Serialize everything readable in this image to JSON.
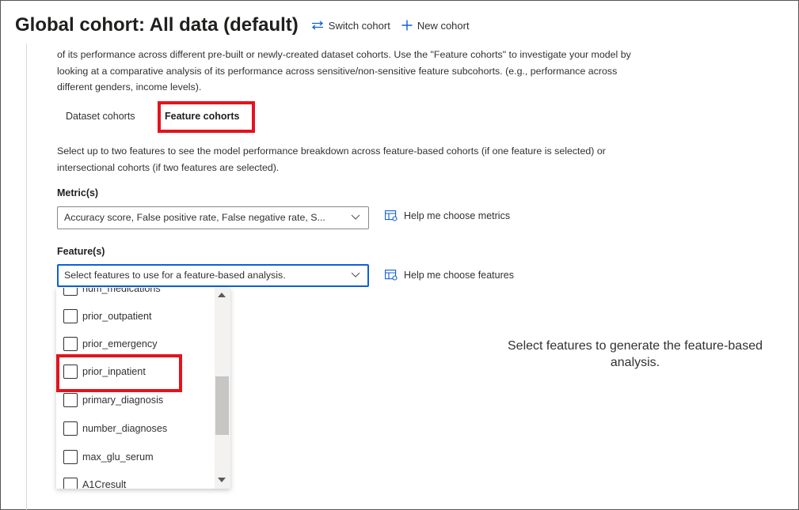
{
  "header": {
    "title": "Global cohort: All data (default)",
    "switch_cohort": "Switch cohort",
    "new_cohort": "New cohort"
  },
  "intro_text": "of its performance across different pre-built or newly-created dataset cohorts. Use the \"Feature cohorts\" to investigate your model by looking at a comparative analysis of its performance across sensitive/non-sensitive feature subcohorts. (e.g., performance across different genders, income levels).",
  "tabs": [
    {
      "label": "Dataset cohorts",
      "selected": false
    },
    {
      "label": "Feature cohorts",
      "selected": true
    }
  ],
  "description": "Select up to two features to see the model performance breakdown across feature-based cohorts (if one feature is selected) or intersectional cohorts (if two features are selected).",
  "metrics": {
    "label": "Metric(s)",
    "value": "Accuracy score, False positive rate, False negative rate, S...",
    "help": "Help me choose metrics"
  },
  "features": {
    "label": "Feature(s)",
    "placeholder": "Select features to use for a feature-based analysis.",
    "help": "Help me choose features",
    "options": [
      {
        "label": "num_medications",
        "checked": false
      },
      {
        "label": "prior_outpatient",
        "checked": false
      },
      {
        "label": "prior_emergency",
        "checked": false
      },
      {
        "label": "prior_inpatient",
        "checked": false
      },
      {
        "label": "primary_diagnosis",
        "checked": false
      },
      {
        "label": "number_diagnoses",
        "checked": false
      },
      {
        "label": "max_glu_serum",
        "checked": false
      },
      {
        "label": "A1Cresult",
        "checked": false
      }
    ]
  },
  "empty_message": "Select features to generate the feature-based analysis.",
  "colors": {
    "highlight": "#e3131d",
    "accent": "#0f5fd7",
    "tab_underline": "#7a2bb8"
  }
}
